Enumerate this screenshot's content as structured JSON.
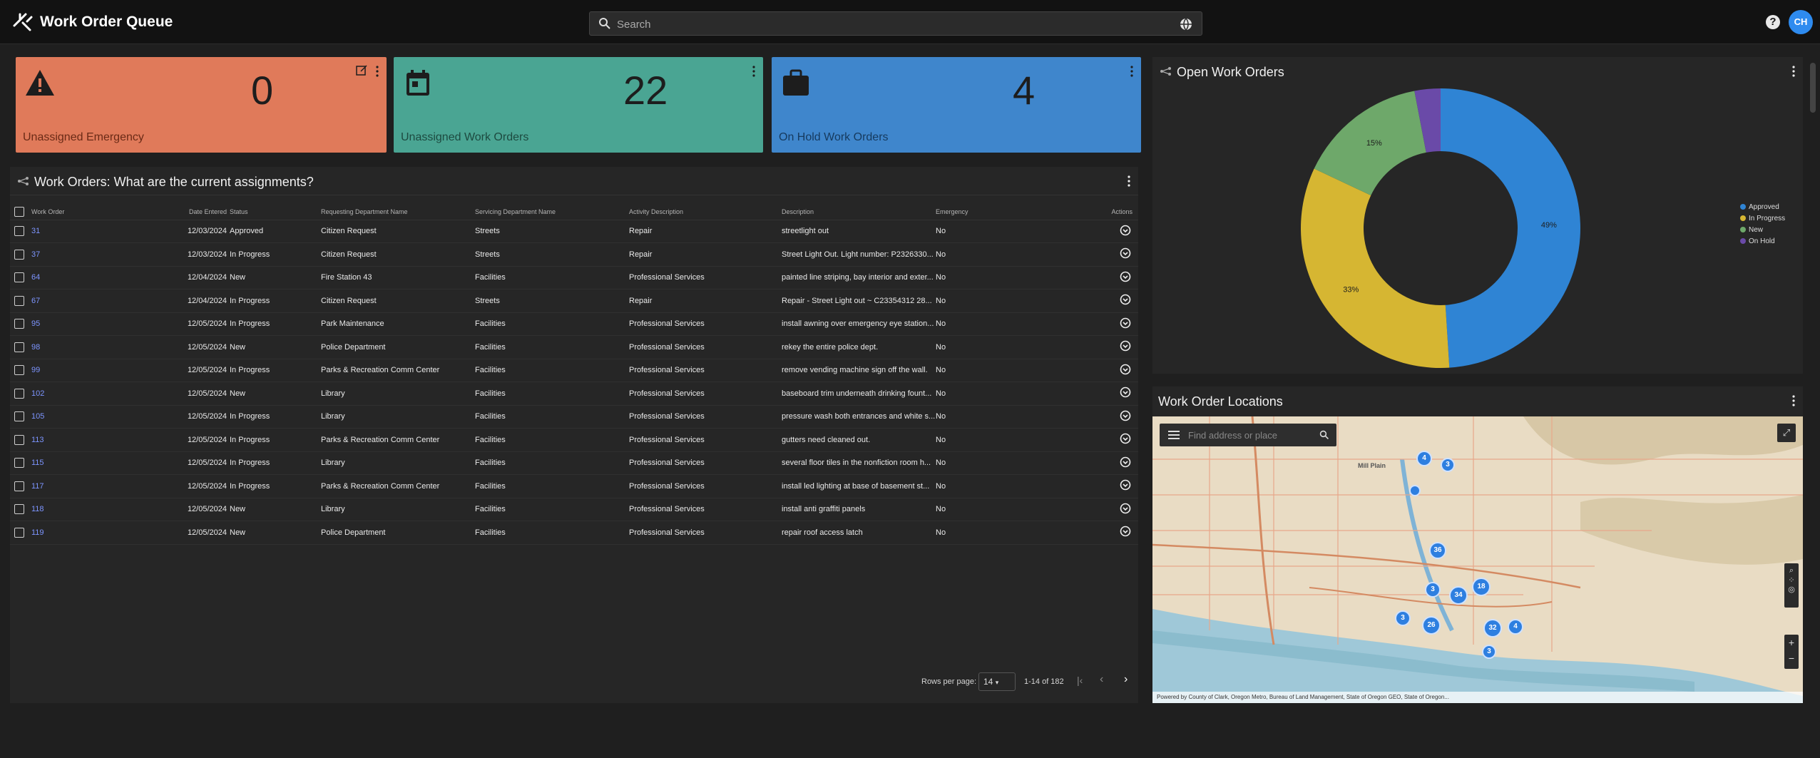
{
  "app": {
    "title": "Work Order Queue",
    "user_initials": "CH",
    "help_label": "?"
  },
  "search": {
    "placeholder": "Search"
  },
  "kpis": [
    {
      "value": "0",
      "label": "Unassigned Emergency",
      "color": "#e07a5a",
      "icon": "warning-icon"
    },
    {
      "value": "22",
      "label": "Unassigned Work Orders",
      "color": "#4aa593",
      "icon": "calendar-icon"
    },
    {
      "value": "4",
      "label": "On Hold Work Orders",
      "color": "#3f86cc",
      "icon": "briefcase-icon"
    }
  ],
  "table_panel": {
    "title": "Work Orders: What are the current assignments?",
    "columns": [
      "Work Order",
      "Date Entered",
      "Status",
      "Requesting Department Name",
      "Servicing Department Name",
      "Activity Description",
      "Description",
      "Emergency",
      "Actions"
    ],
    "rows": [
      {
        "wo": "31",
        "date": "12/03/2024",
        "status": "Approved",
        "req": "Citizen Request",
        "svc": "Streets",
        "activity": "Repair",
        "desc": "streetlight out",
        "emergency": "No"
      },
      {
        "wo": "37",
        "date": "12/03/2024",
        "status": "In Progress",
        "req": "Citizen Request",
        "svc": "Streets",
        "activity": "Repair",
        "desc": "Street Light Out. Light number: P2326330...",
        "emergency": "No"
      },
      {
        "wo": "64",
        "date": "12/04/2024",
        "status": "New",
        "req": "Fire Station 43",
        "svc": "Facilities",
        "activity": "Professional Services",
        "desc": "painted line striping, bay interior and exter...",
        "emergency": "No"
      },
      {
        "wo": "67",
        "date": "12/04/2024",
        "status": "In Progress",
        "req": "Citizen Request",
        "svc": "Streets",
        "activity": "Repair",
        "desc": "Repair - Street Light out ~ C23354312  28...",
        "emergency": "No"
      },
      {
        "wo": "95",
        "date": "12/05/2024",
        "status": "In Progress",
        "req": "Park Maintenance",
        "svc": "Facilities",
        "activity": "Professional Services",
        "desc": "install awning over emergency eye station...",
        "emergency": "No"
      },
      {
        "wo": "98",
        "date": "12/05/2024",
        "status": "New",
        "req": "Police Department",
        "svc": "Facilities",
        "activity": "Professional Services",
        "desc": "rekey the entire police dept.",
        "emergency": "No"
      },
      {
        "wo": "99",
        "date": "12/05/2024",
        "status": "In Progress",
        "req": "Parks & Recreation Comm Center",
        "svc": "Facilities",
        "activity": "Professional Services",
        "desc": "remove vending machine sign off the wall.",
        "emergency": "No"
      },
      {
        "wo": "102",
        "date": "12/05/2024",
        "status": "New",
        "req": "Library",
        "svc": "Facilities",
        "activity": "Professional Services",
        "desc": "baseboard trim underneath drinking fount...",
        "emergency": "No"
      },
      {
        "wo": "105",
        "date": "12/05/2024",
        "status": "In Progress",
        "req": "Library",
        "svc": "Facilities",
        "activity": "Professional Services",
        "desc": "pressure wash both entrances and white s...",
        "emergency": "No"
      },
      {
        "wo": "113",
        "date": "12/05/2024",
        "status": "In Progress",
        "req": "Parks & Recreation Comm Center",
        "svc": "Facilities",
        "activity": "Professional Services",
        "desc": "gutters need cleaned out.",
        "emergency": "No"
      },
      {
        "wo": "115",
        "date": "12/05/2024",
        "status": "In Progress",
        "req": "Library",
        "svc": "Facilities",
        "activity": "Professional Services",
        "desc": "several floor tiles in the nonfiction room h...",
        "emergency": "No"
      },
      {
        "wo": "117",
        "date": "12/05/2024",
        "status": "In Progress",
        "req": "Parks & Recreation Comm Center",
        "svc": "Facilities",
        "activity": "Professional Services",
        "desc": "install led lighting at base of basement st...",
        "emergency": "No"
      },
      {
        "wo": "118",
        "date": "12/05/2024",
        "status": "New",
        "req": "Library",
        "svc": "Facilities",
        "activity": "Professional Services",
        "desc": "install anti graffiti panels",
        "emergency": "No"
      },
      {
        "wo": "119",
        "date": "12/05/2024",
        "status": "New",
        "req": "Police Department",
        "svc": "Facilities",
        "activity": "Professional Services",
        "desc": "repair roof access latch",
        "emergency": "No"
      }
    ],
    "pager": {
      "rows_per_page_label": "Rows per page:",
      "rows_per_page": "14",
      "range": "1-14 of 182"
    }
  },
  "chart_panel": {
    "title": "Open Work Orders"
  },
  "chart_data": {
    "type": "pie",
    "categories": [
      "Approved",
      "In Progress",
      "New",
      "On Hold"
    ],
    "values": [
      49,
      33,
      15,
      3
    ],
    "data_labels": [
      "49%",
      "33%",
      "15%",
      ""
    ],
    "colors": [
      "#2f84d4",
      "#d6b632",
      "#6ea86a",
      "#6a4aa8"
    ],
    "legend": "right"
  },
  "map_panel": {
    "title": "Work Order Locations",
    "search_placeholder": "Find address or place",
    "place_label": "Mill Plain",
    "clusters": [
      "4",
      "3",
      "",
      "36",
      "3",
      "34",
      "18",
      "3",
      "26",
      "32",
      "4",
      "3"
    ],
    "attribution": "Powered by  County of Clark, Oregon Metro, Bureau of Land Management, State of Oregon GEO, State of Oregon..."
  }
}
